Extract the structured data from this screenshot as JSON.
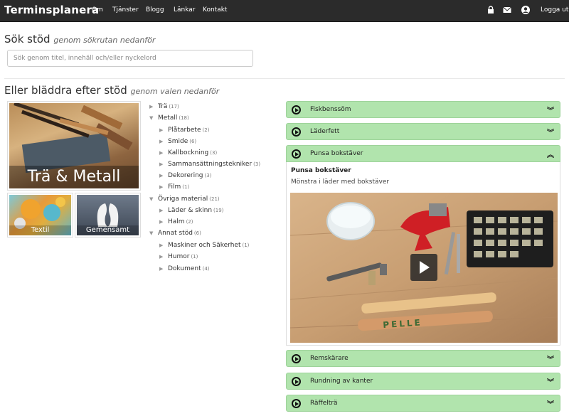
{
  "navbar": {
    "brand": "Terminsplanera",
    "links": [
      "Om",
      "Tjänster",
      "Blogg",
      "Länkar",
      "Kontakt"
    ],
    "icons": [
      "lock-icon",
      "envelope-icon",
      "user-icon"
    ],
    "logout": "Logga ut"
  },
  "search": {
    "heading": "Sök stöd",
    "subheading": "genom sökrutan nedanför",
    "placeholder": "Sök genom titel, innehåll och/eller nyckelord"
  },
  "browse": {
    "heading": "Eller bläddra efter stöd",
    "subheading": "genom valen nedanför"
  },
  "tiles": {
    "main": "Trä & Metall",
    "textil": "Textil",
    "gemensamt": "Gemensamt"
  },
  "tree": [
    {
      "label": "Trä",
      "count": "(17)"
    },
    {
      "label": "Metall",
      "count": "(18)"
    },
    {
      "label": "Plåtarbete",
      "count": "(2)"
    },
    {
      "label": "Smide",
      "count": "(6)"
    },
    {
      "label": "Kallbockning",
      "count": "(3)"
    },
    {
      "label": "Sammansättningstekniker",
      "count": "(3)"
    },
    {
      "label": "Dekorering",
      "count": "(3)"
    },
    {
      "label": "Film",
      "count": "(1)"
    },
    {
      "label": "Övriga material",
      "count": "(21)"
    },
    {
      "label": "Läder & skinn",
      "count": "(19)"
    },
    {
      "label": "Halm",
      "count": "(2)"
    },
    {
      "label": "Annat stöd",
      "count": "(6)"
    },
    {
      "label": "Maskiner och Säkerhet",
      "count": "(1)"
    },
    {
      "label": "Humor",
      "count": "(1)"
    },
    {
      "label": "Dokument",
      "count": "(4)"
    }
  ],
  "accordion": [
    {
      "label": "Fiskbenssöm",
      "expanded": false
    },
    {
      "label": "Läderfett",
      "expanded": false
    },
    {
      "label": "Punsa bokstäver",
      "expanded": true
    },
    {
      "label": "Remskärare",
      "expanded": false
    },
    {
      "label": "Rundning av kanter",
      "expanded": false
    },
    {
      "label": "Räffelträ",
      "expanded": false
    }
  ],
  "panel": {
    "title": "Punsa bokstäver",
    "description": "Mönstra i läder med bokstäver",
    "video_text": "PELLE"
  },
  "colors": {
    "navbar": "#2b2b2b",
    "accordion": "#b1e4ad"
  }
}
